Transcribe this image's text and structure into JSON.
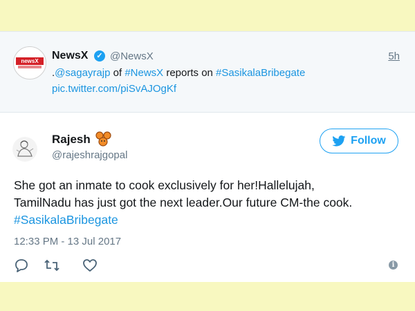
{
  "quoted_tweet": {
    "logo_text": "newsX",
    "name": "NewsX",
    "handle": "@NewsX",
    "time": "5h",
    "text_prefix": ".",
    "mention": "@sagayrajp",
    "text_mid1": " of ",
    "hashtag1": "#NewsX",
    "text_mid2": " reports on ",
    "hashtag2": "#SasikalaBribegate",
    "link": "pic.twitter.com/piSvAJOgKf"
  },
  "tweet": {
    "name": "Rajesh",
    "handle": "@rajeshrajgopal",
    "follow_label": "Follow",
    "text_line1": "She got an inmate to cook exclusively for her!Hallelujah,",
    "text_line2": "TamilNadu has just got the next leader.Our future CM-the cook.",
    "hashtag": "#SasikalaBribegate",
    "timestamp": "12:33 PM - 13 Jul 2017"
  },
  "icons": {
    "verified": "verified-badge-icon",
    "bird": "twitter-bird-icon",
    "reply": "reply-icon",
    "retweet": "retweet-icon",
    "like": "heart-icon",
    "info": "info-icon",
    "name_emoji": "paw-emoji-icon"
  },
  "colors": {
    "background": "#f8f8c0",
    "twitter_blue": "#1da1f2",
    "link_blue": "#1b95e0",
    "text": "#14171a",
    "muted": "#657786",
    "newsx_red": "#d42027"
  }
}
